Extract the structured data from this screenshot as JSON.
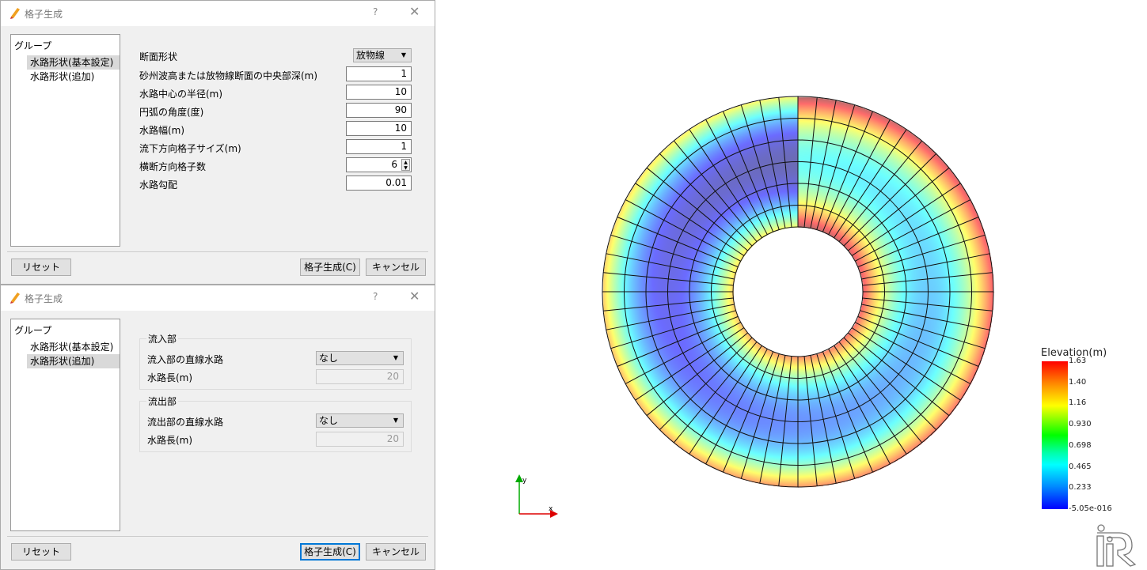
{
  "dialog1": {
    "title": "格子生成",
    "help": "?",
    "close": "✕",
    "tree": {
      "header": "グループ",
      "items": [
        "水路形状(基本設定)",
        "水路形状(追加)"
      ],
      "selected": 0
    },
    "fields": [
      {
        "label": "断面形状",
        "value": "放物線",
        "type": "select"
      },
      {
        "label": "砂州波高または放物線断面の中央部深(m)",
        "value": "1"
      },
      {
        "label": "水路中心の半径(m)",
        "value": "10"
      },
      {
        "label": "円弧の角度(度)",
        "value": "90"
      },
      {
        "label": "水路幅(m)",
        "value": "10"
      },
      {
        "label": "流下方向格子サイズ(m)",
        "value": "1"
      },
      {
        "label": "横断方向格子数",
        "value": "6",
        "type": "spin"
      },
      {
        "label": "水路勾配",
        "value": "0.01"
      }
    ],
    "reset": "リセット",
    "generate": "格子生成(C)",
    "cancel": "キャンセル"
  },
  "dialog2": {
    "title": "格子生成",
    "help": "?",
    "close": "✕",
    "tree": {
      "header": "グループ",
      "items": [
        "水路形状(基本設定)",
        "水路形状(追加)"
      ],
      "selected": 1
    },
    "inflow": {
      "title": "流入部",
      "straight_label": "流入部の直線水路",
      "straight_value": "なし",
      "length_label": "水路長(m)",
      "length_value": "20"
    },
    "outflow": {
      "title": "流出部",
      "straight_label": "流出部の直線水路",
      "straight_value": "なし",
      "length_label": "水路長(m)",
      "length_value": "20"
    },
    "reset": "リセット",
    "generate": "格子生成(C)",
    "cancel": "キャンセル"
  },
  "viewer": {
    "grid": {
      "streamwise_cells": 64,
      "cross_cells": 6
    },
    "colorbar": {
      "title": "Elevation(m)",
      "min": -5.05e-16,
      "max": 1.63,
      "ticks": [
        "1.63",
        "1.40",
        "1.16",
        "0.930",
        "0.698",
        "0.465",
        "0.233",
        "-5.05e-016"
      ]
    },
    "axes": {
      "x": "x",
      "y": "y"
    },
    "logo": "iRIC"
  }
}
